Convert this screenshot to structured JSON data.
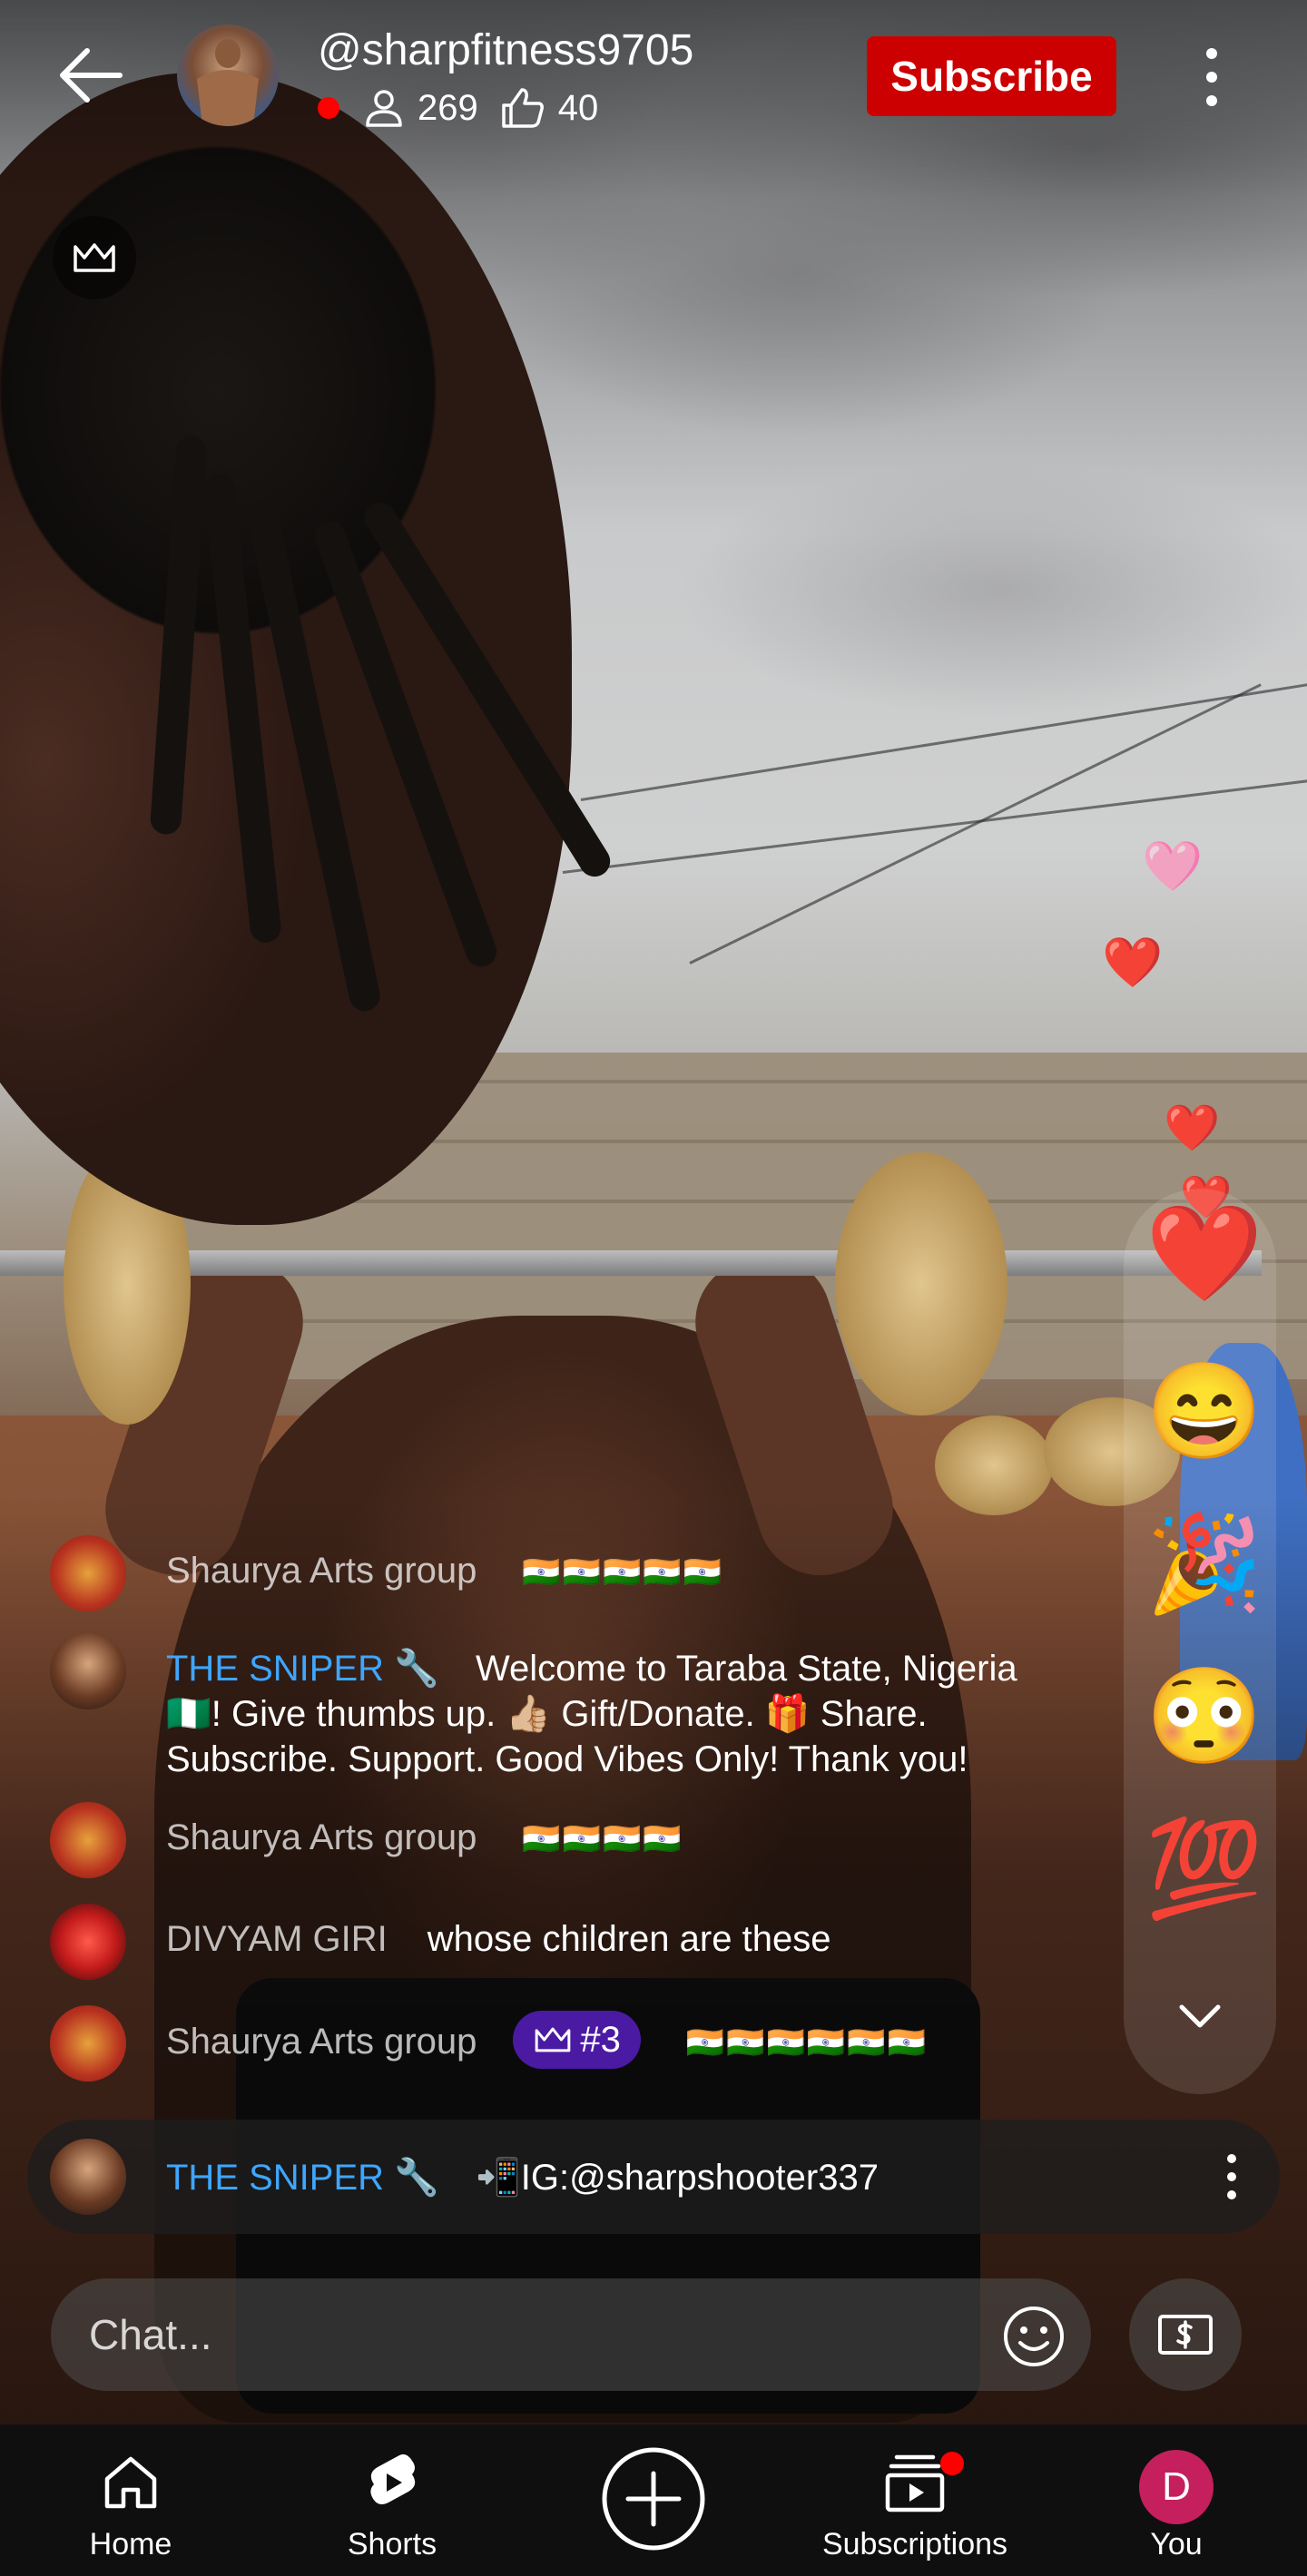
{
  "header": {
    "channel_handle": "@sharpfitness9705",
    "viewer_count": "269",
    "like_count": "40",
    "subscribe_label": "Subscribe"
  },
  "floating_reactions": [
    "🩷",
    "❤️",
    "❤️",
    "❤️"
  ],
  "reaction_panel": [
    "❤️",
    "😄",
    "🎉",
    "😳",
    "💯"
  ],
  "chat": [
    {
      "author": "Shaurya Arts group",
      "author_color": "grey",
      "text": "🇮🇳🇮🇳🇮🇳🇮🇳🇮🇳"
    },
    {
      "author": "THE SNIPER 🔧",
      "author_color": "blue",
      "text": "Welcome to Taraba State, Nigeria 🇳🇬! Give thumbs up. 👍🏼 Gift/Donate. 🎁 Share. Subscribe. Support. Good Vibes Only! Thank you!"
    },
    {
      "author": "Shaurya Arts group",
      "author_color": "grey",
      "text": "🇮🇳🇮🇳🇮🇳🇮🇳"
    },
    {
      "author": "DIVYAM GIRI",
      "author_color": "grey",
      "text": "whose children are these"
    },
    {
      "author": "Shaurya Arts group",
      "author_color": "grey",
      "badge": "#3",
      "text": "🇮🇳🇮🇳🇮🇳🇮🇳🇮🇳🇮🇳"
    }
  ],
  "pinned": {
    "author": "THE SNIPER 🔧",
    "text": "📲IG:@sharpshooter337"
  },
  "chat_input": {
    "placeholder": "Chat..."
  },
  "nav": {
    "home": "Home",
    "shorts": "Shorts",
    "subscriptions": "Subscriptions",
    "you": "You",
    "you_initial": "D"
  },
  "colors": {
    "subscribe": "#cc0000",
    "live_dot": "#ff0000",
    "blue_author": "#3ea6ff",
    "badge": "#4b1aa3",
    "you_avatar": "#c51f5d"
  },
  "icons": [
    "back-arrow-icon",
    "viewer-person-icon",
    "thumbs-up-icon",
    "more-vert-icon",
    "crown-icon",
    "chevron-down-icon",
    "emoji-icon",
    "super-chat-icon",
    "home-icon",
    "shorts-icon",
    "create-plus-icon",
    "subscriptions-icon"
  ]
}
